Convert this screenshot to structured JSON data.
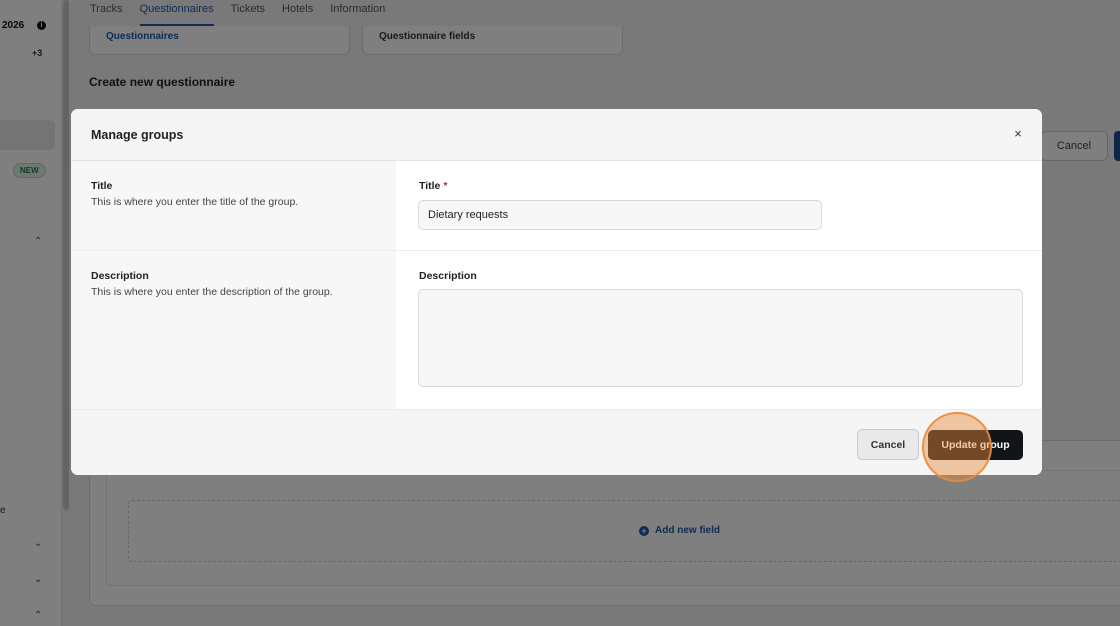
{
  "sidebar": {
    "year": "2026",
    "count": "+3",
    "new_badge": "NEW",
    "truncated_item": "e"
  },
  "tabs": [
    {
      "label": "Tracks"
    },
    {
      "label": "Questionnaires"
    },
    {
      "label": "Tickets"
    },
    {
      "label": "Hotels"
    },
    {
      "label": "Information"
    }
  ],
  "subtabs": {
    "questionnaires": "Questionnaires",
    "fields": "Questionnaire fields"
  },
  "page": {
    "create_title": "Create new questionnaire",
    "cancel_label": "Cancel",
    "add_field_label": "Add new field"
  },
  "modal": {
    "title": "Manage groups",
    "close_symbol": "×",
    "title_section": {
      "heading": "Title",
      "description": "This is where you enter the title of the group.",
      "field_label": "Title",
      "required_mark": "*",
      "value": "Dietary requests"
    },
    "description_section": {
      "heading": "Description",
      "description": "This is where you enter the description of the group.",
      "field_label": "Description",
      "value": ""
    },
    "footer": {
      "cancel_label": "Cancel",
      "update_label": "Update group"
    }
  }
}
